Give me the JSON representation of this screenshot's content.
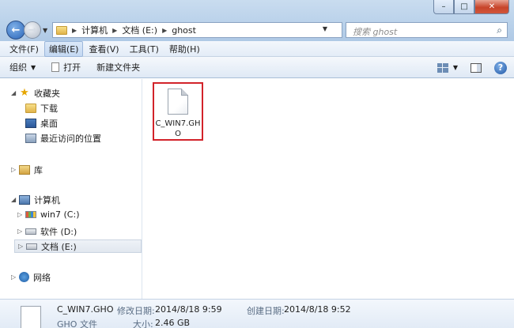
{
  "window": {
    "minimize_glyph": "–",
    "maximize_glyph": "□",
    "close_glyph": "✕"
  },
  "address": {
    "crumbs": [
      "计算机",
      "文档 (E:)",
      "ghost"
    ]
  },
  "search": {
    "placeholder": "搜索 ghost"
  },
  "menu": [
    "文件(F)",
    "编辑(E)",
    "查看(V)",
    "工具(T)",
    "帮助(H)"
  ],
  "commands": {
    "organize": "组织",
    "open": "打开",
    "new_folder": "新建文件夹"
  },
  "nav": {
    "favorites": "收藏夹",
    "downloads": "下载",
    "desktop": "桌面",
    "recent": "最近访问的位置",
    "libraries": "库",
    "computer": "计算机",
    "drive_c": "win7 (C:)",
    "drive_d": "软件 (D:)",
    "drive_e": "文档 (E:)",
    "network": "网络"
  },
  "files": [
    {
      "name": "C_WIN7.GHO"
    }
  ],
  "details": {
    "name": "C_WIN7.GHO",
    "type": "GHO 文件",
    "modified_label": "修改日期:",
    "modified_value": "2014/8/18 9:59",
    "created_label": "创建日期:",
    "created_value": "2014/8/18 9:52",
    "size_label": "大小:",
    "size_value": "2.46 GB"
  }
}
